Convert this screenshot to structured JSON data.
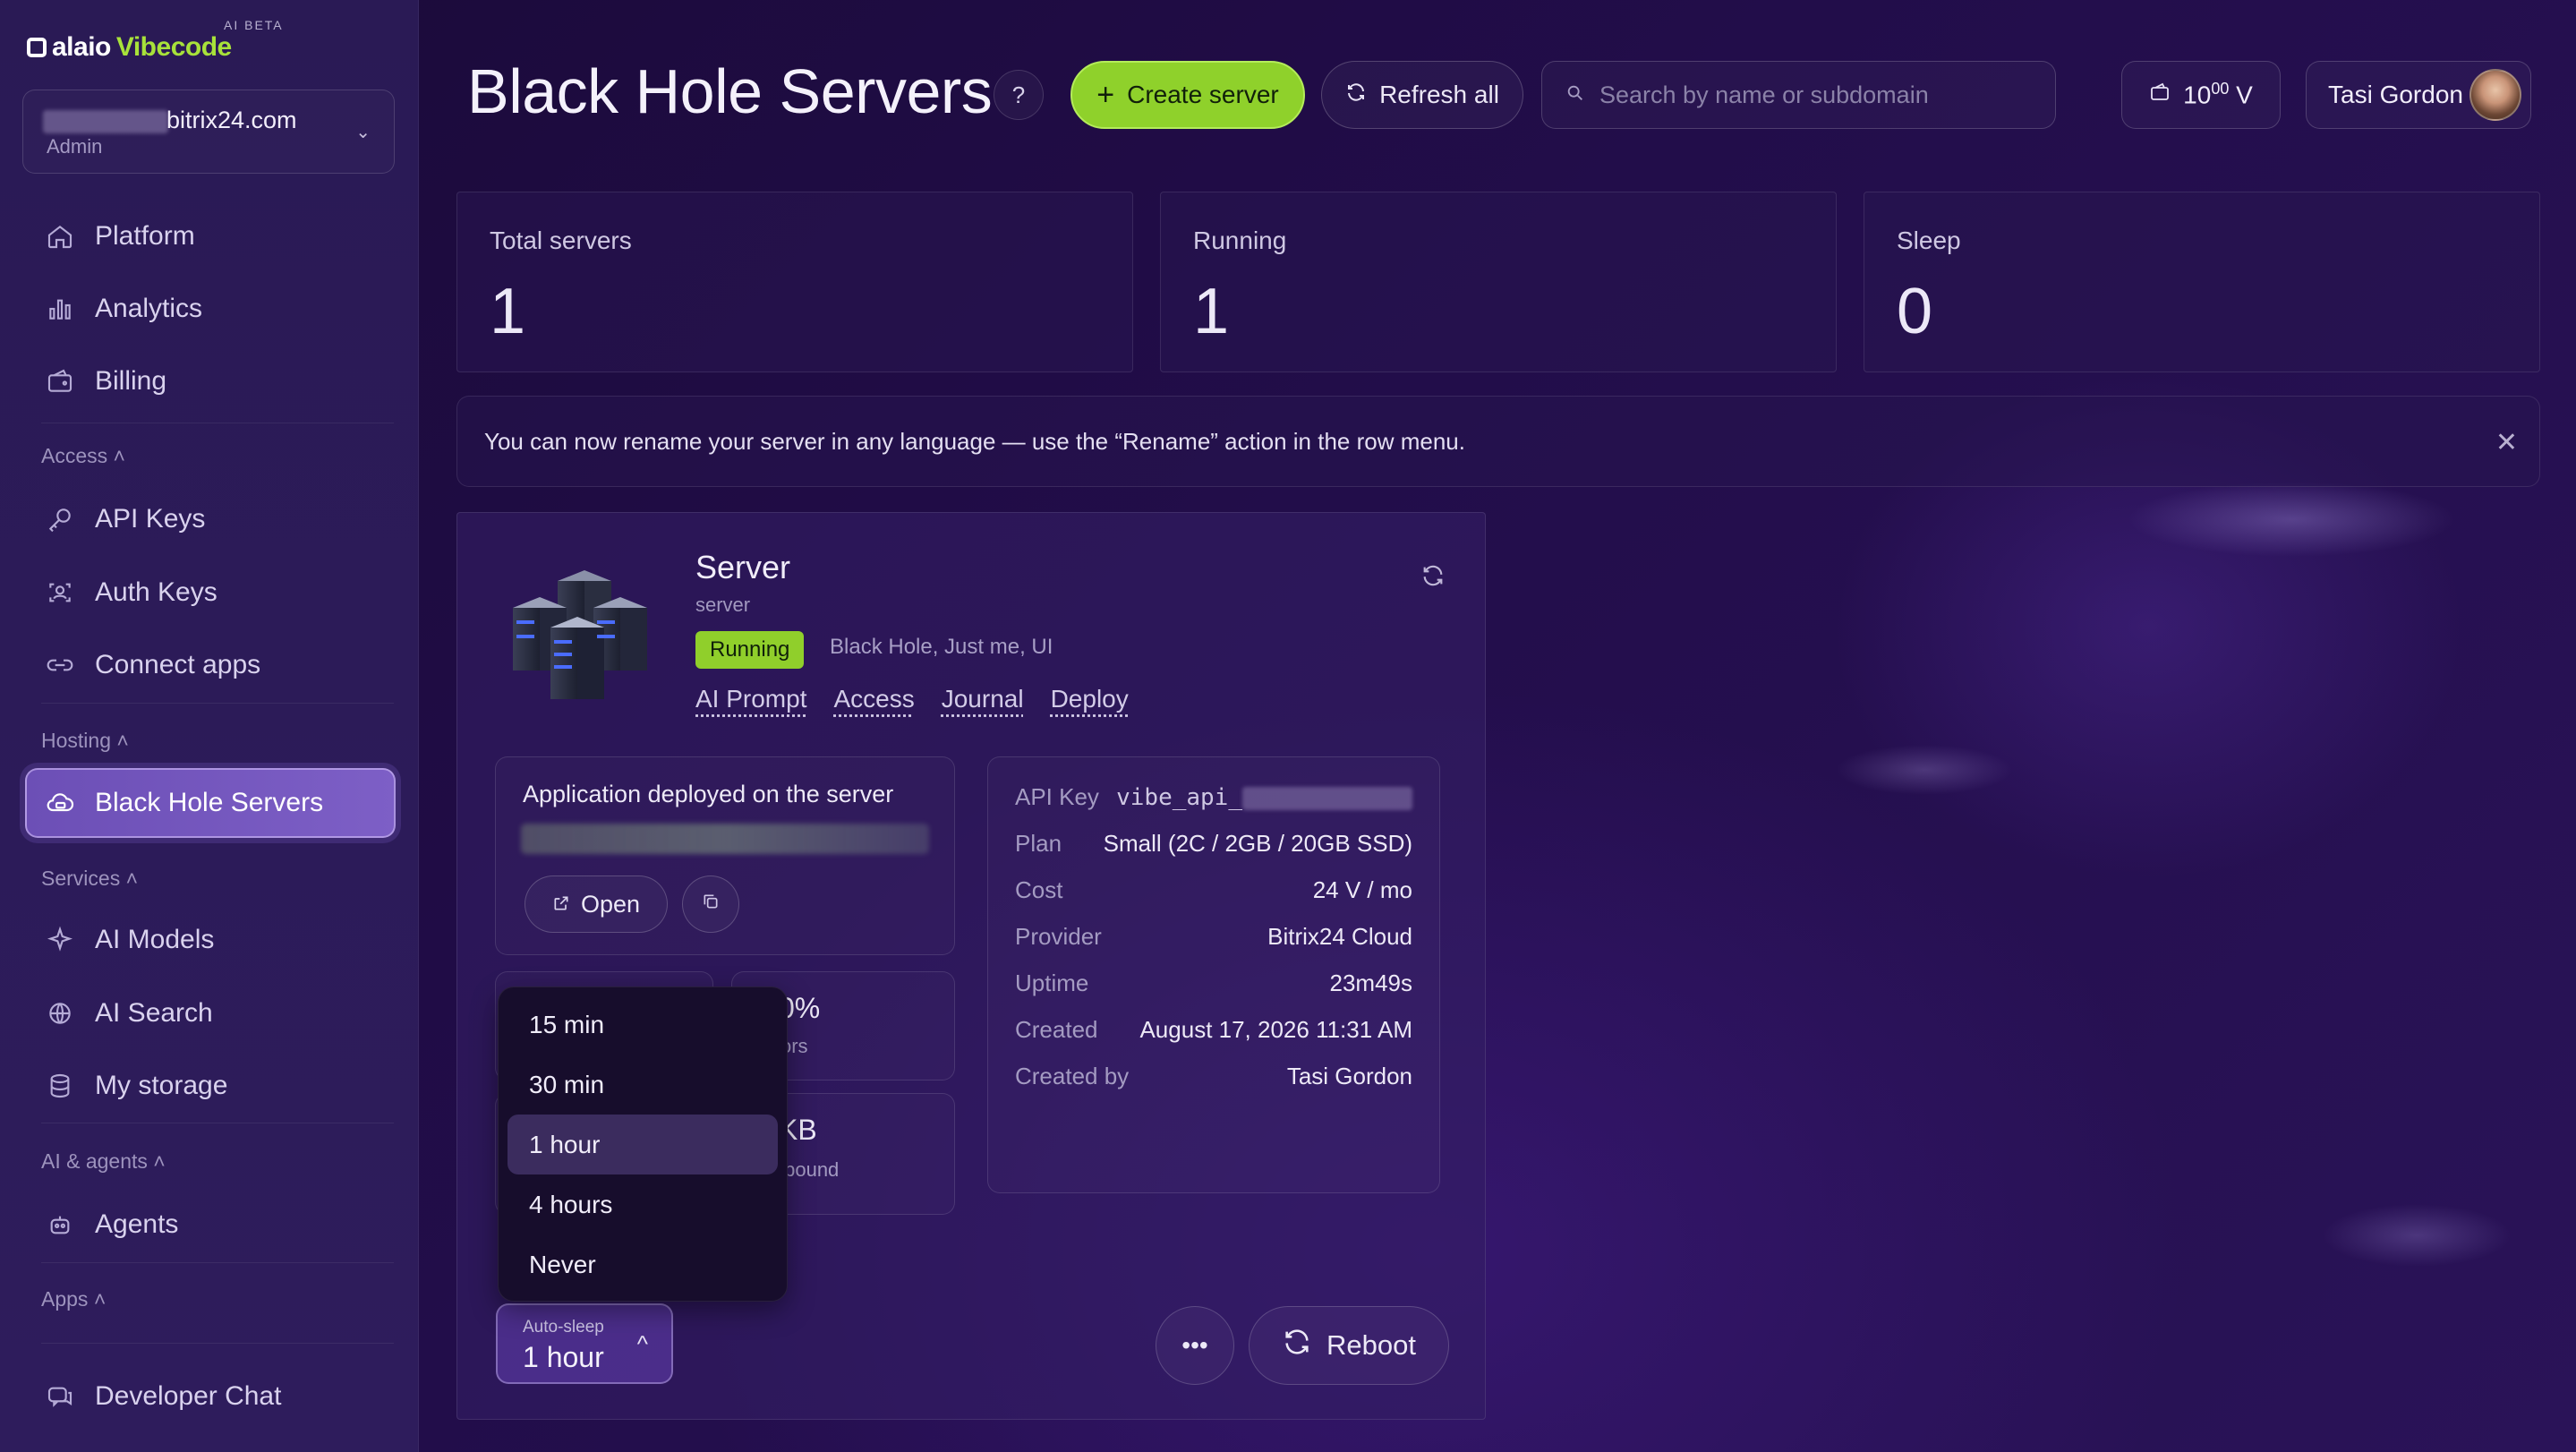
{
  "brand": {
    "name_prefix": "alaio",
    "name_suffix": "Vibecode",
    "beta": "AI BETA"
  },
  "account": {
    "domain": "bitrix24.com",
    "role": "Admin"
  },
  "sidebar": {
    "items": [
      {
        "label": "Platform"
      },
      {
        "label": "Analytics"
      },
      {
        "label": "Billing"
      },
      {
        "label": "API Keys"
      },
      {
        "label": "Auth Keys"
      },
      {
        "label": "Connect apps"
      },
      {
        "label": "Black Hole Servers"
      },
      {
        "label": "AI Models"
      },
      {
        "label": "AI Search"
      },
      {
        "label": "My storage"
      },
      {
        "label": "Agents"
      },
      {
        "label": "Developer Chat"
      }
    ],
    "sections": {
      "access": "Access",
      "hosting": "Hosting",
      "services": "Services",
      "ai_agents": "AI & agents",
      "apps": "Apps"
    }
  },
  "header": {
    "title": "Black Hole Servers",
    "help": "?",
    "create_label": "Create server",
    "refresh_label": "Refresh all",
    "search_placeholder": "Search by name or subdomain",
    "balance_main": "10",
    "balance_frac": "00",
    "currency": "V",
    "user_name": "Tasi Gordon"
  },
  "stats": [
    {
      "label": "Total servers",
      "value": "1"
    },
    {
      "label": "Running",
      "value": "1"
    },
    {
      "label": "Sleep",
      "value": "0"
    }
  ],
  "notice": {
    "text": "You can now rename your server in any language — use the “Rename” action in the row menu."
  },
  "server": {
    "name": "Server",
    "subtitle": "server",
    "status": "Running",
    "tags": "Black Hole, Just me, UI",
    "links": [
      "AI Prompt",
      "Access",
      "Journal",
      "Deploy"
    ],
    "deploy_title": "Application deployed on the server",
    "open_label": "Open",
    "metric_errors_value": "0%",
    "metric_errors_label": "ors",
    "metric_traffic_value": "KB",
    "metric_traffic_label": "tbound",
    "info": [
      {
        "k": "API Key",
        "v": "vibe_api_"
      },
      {
        "k": "Plan",
        "v": "Small (2C / 2GB / 20GB SSD)"
      },
      {
        "k": "Cost",
        "v": "24 V / mo"
      },
      {
        "k": "Provider",
        "v": "Bitrix24 Cloud"
      },
      {
        "k": "Uptime",
        "v": "23m49s"
      },
      {
        "k": "Created",
        "v": "August 17, 2026 11:31 AM"
      },
      {
        "k": "Created by",
        "v": "Tasi Gordon"
      }
    ],
    "more_label": "•••",
    "reboot_label": "Reboot",
    "autosleep": {
      "label": "Auto-sleep",
      "value": "1 hour",
      "options": [
        "15 min",
        "30 min",
        "1 hour",
        "4 hours",
        "Never"
      ]
    }
  },
  "colors": {
    "accent": "#8fd12b",
    "background": "#1a0a38",
    "sidebar": "#2a1a55",
    "active_nav": "#6c4fb6"
  }
}
